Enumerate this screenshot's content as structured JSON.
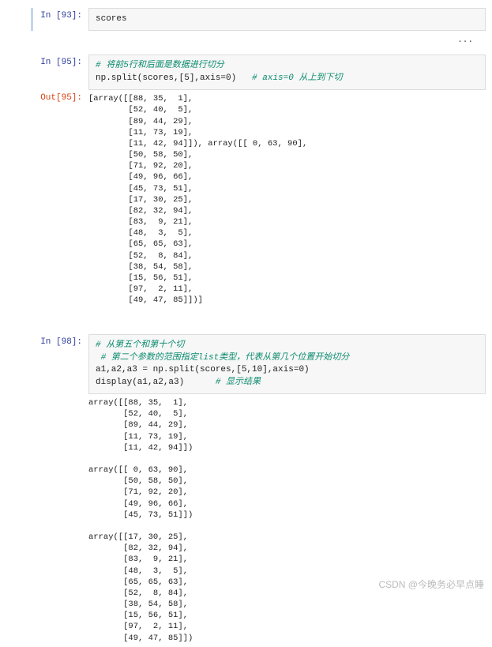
{
  "cell93": {
    "prompt": "In  [93]:",
    "code_plain": "scores",
    "ellipsis": "..."
  },
  "cell95": {
    "prompt": "In  [95]:",
    "comment1": "# 将前5行和后面是数据进行切分",
    "code_line": "np.split(scores,[5],axis=0)",
    "comment2": "   # axis=0 从上到下切",
    "out_prompt": "Out[95]:",
    "output": "[array([[88, 35,  1],\n        [52, 40,  5],\n        [89, 44, 29],\n        [11, 73, 19],\n        [11, 42, 94]]), array([[ 0, 63, 90],\n        [50, 58, 50],\n        [71, 92, 20],\n        [49, 96, 66],\n        [45, 73, 51],\n        [17, 30, 25],\n        [82, 32, 94],\n        [83,  9, 21],\n        [48,  3,  5],\n        [65, 65, 63],\n        [52,  8, 84],\n        [38, 54, 58],\n        [15, 56, 51],\n        [97,  2, 11],\n        [49, 47, 85]])]"
  },
  "cell98": {
    "prompt": "In  [98]:",
    "comment1": "# 从第五个和第十个切",
    "comment2": " # 第二个参数的范围指定list类型，代表从第几个位置开始切分",
    "code_line1": "a1,a2,a3 = np.split(scores,[5,10],axis=0)",
    "code_line2": "display(a1,a2,a3)",
    "comment3": "      # 显示结果",
    "output": "array([[88, 35,  1],\n       [52, 40,  5],\n       [89, 44, 29],\n       [11, 73, 19],\n       [11, 42, 94]])\n\narray([[ 0, 63, 90],\n       [50, 58, 50],\n       [71, 92, 20],\n       [49, 96, 66],\n       [45, 73, 51]])\n\narray([[17, 30, 25],\n       [82, 32, 94],\n       [83,  9, 21],\n       [48,  3,  5],\n       [65, 65, 63],\n       [52,  8, 84],\n       [38, 54, 58],\n       [15, 56, 51],\n       [97,  2, 11],\n       [49, 47, 85]])"
  },
  "watermark": "CSDN @今晚务必早点睡"
}
